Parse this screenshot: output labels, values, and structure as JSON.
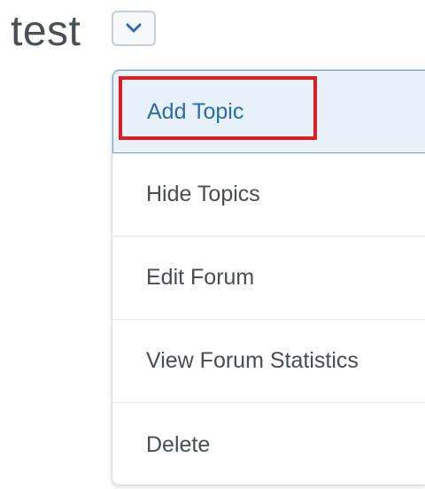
{
  "forum": {
    "title": "test"
  },
  "toggle": {
    "icon": "chevron-down-icon",
    "accent": "#2b6cb0"
  },
  "menu": {
    "items": [
      {
        "label": "Add Topic",
        "active": true
      },
      {
        "label": "Hide Topics",
        "active": false
      },
      {
        "label": "Edit Forum",
        "active": false
      },
      {
        "label": "View Forum Statistics",
        "active": false
      },
      {
        "label": "Delete",
        "active": false
      }
    ]
  },
  "annotation": {
    "highlight_color": "#e21b23"
  }
}
